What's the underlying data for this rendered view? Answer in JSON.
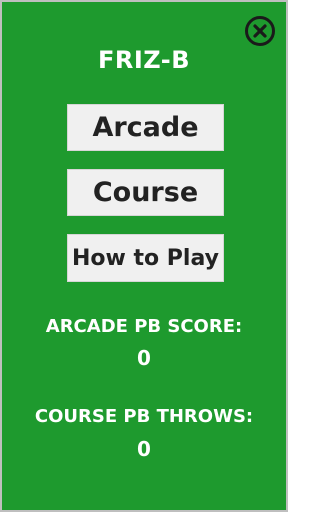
{
  "header": {
    "title": "FRIZ-B",
    "close_icon": "close-icon"
  },
  "menu": {
    "arcade_label": "Arcade",
    "course_label": "Course",
    "how_to_play_label": "How to Play"
  },
  "stats": {
    "arcade_pb_label": "ARCADE PB SCORE:",
    "arcade_pb_value": "0",
    "course_pb_label": "COURSE PB THROWS:",
    "course_pb_value": "0"
  },
  "colors": {
    "background": "#1e9a2e",
    "button_background": "#f0f0f0",
    "button_text": "#222222",
    "text": "#ffffff"
  }
}
